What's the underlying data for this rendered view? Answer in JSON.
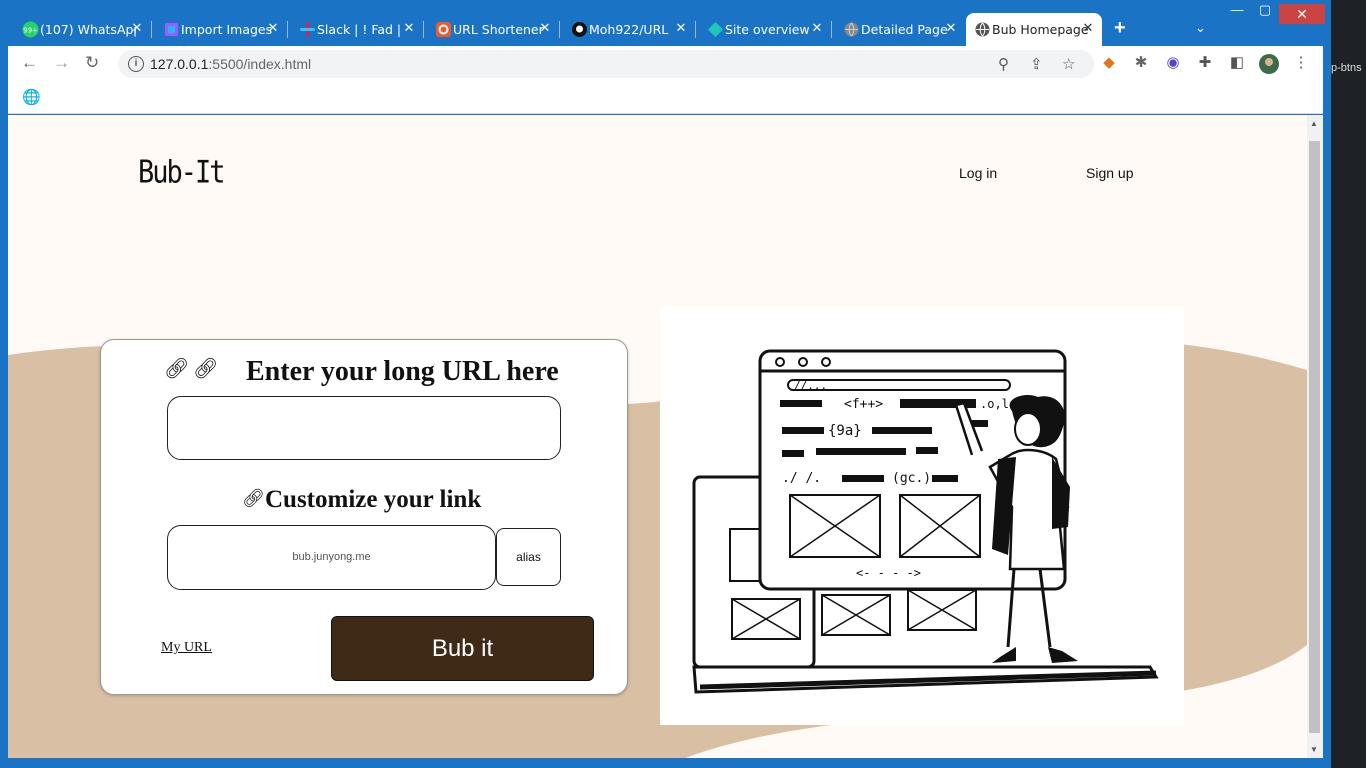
{
  "browser": {
    "tabs": [
      {
        "label": "(107) WhatsApp",
        "favicon": "whatsapp-icon",
        "badge": "99+",
        "color": "#25d366"
      },
      {
        "label": "Import Images",
        "favicon": "figma-icon",
        "color": "#a259ff"
      },
      {
        "label": "Slack | ! Fad |",
        "favicon": "slack-icon",
        "color": "#e01e5a"
      },
      {
        "label": "URL Shortener",
        "favicon": "url-shortener-icon",
        "color": "#ef5a2a"
      },
      {
        "label": "Moh922/URL",
        "favicon": "github-icon",
        "color": "#111111"
      },
      {
        "label": "Site overview",
        "favicon": "netlify-icon",
        "color": "#20c6b7"
      },
      {
        "label": "Detailed Page",
        "favicon": "globe-icon",
        "color": "#888888"
      },
      {
        "label": "Bub Homepage",
        "favicon": "globe-icon",
        "color": "#555555",
        "active": true
      }
    ],
    "url_host": "127.0.0.1",
    "url_path": ":5500/index.html"
  },
  "devtools": {
    "snippet": "p-btns"
  },
  "site": {
    "logo": "Bub-It",
    "nav": {
      "login": "Log in",
      "signup": "Sign up"
    },
    "form": {
      "heading": "Enter your long URL here",
      "customize_heading": "Customize your link",
      "domain_placeholder": "bub.junyong.me",
      "alias_label": "alias",
      "my_url_link": "My URL",
      "submit_label": "Bub it"
    },
    "illustration": {
      "code_text_1": "//...",
      "code_text_2": "<f++>",
      "code_text_3": ".o,l",
      "code_text_4": "{9a}",
      "code_text_5": "./ /.",
      "code_text_6": "(gc.)",
      "code_text_7": "<- - - ->"
    }
  },
  "colors": {
    "accent_brown": "#3f2a17",
    "tan": "#d9bfa3",
    "page_bg": "#fffaf6",
    "chrome_blue": "#1a73c4"
  }
}
